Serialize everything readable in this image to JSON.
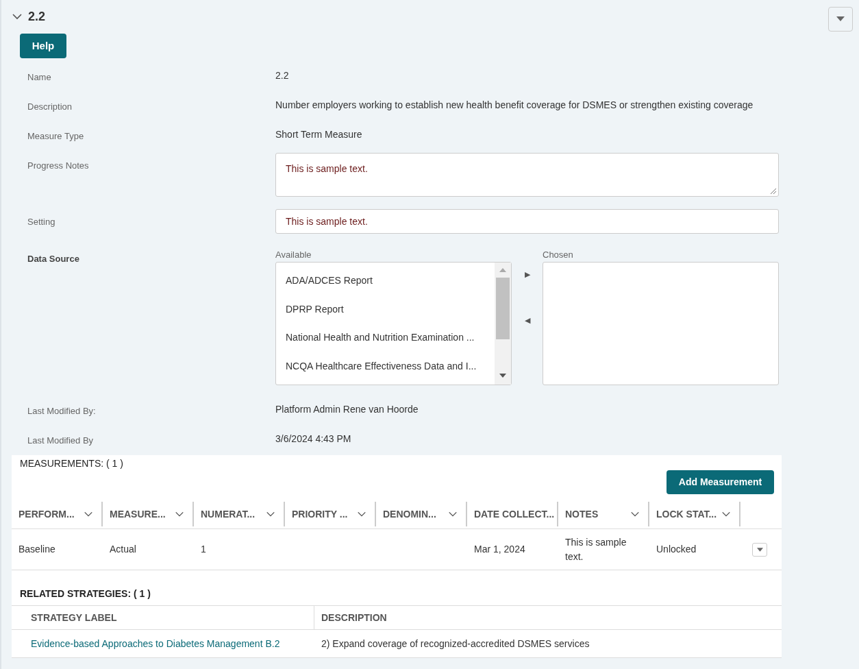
{
  "section": {
    "title": "2.2",
    "expanded": true
  },
  "help_button": "Help",
  "fields": [
    {
      "kind": "text",
      "label": "Name",
      "bold": false,
      "value": "2.2"
    },
    {
      "kind": "text",
      "label": "Description",
      "bold": false,
      "value": "Number employers working to establish new health benefit coverage for DSMES or strengthen existing coverage"
    },
    {
      "kind": "text",
      "label": "Measure Type",
      "bold": false,
      "value": "Short Term Measure"
    },
    {
      "kind": "textarea",
      "label": "Progress Notes",
      "bold": false,
      "value": "This is sample text."
    },
    {
      "kind": "input",
      "label": "Setting",
      "bold": false,
      "value": "This is sample text."
    },
    {
      "kind": "dual_list",
      "label": "Data Source",
      "bold": true,
      "available_label": "Available",
      "chosen_label": "Chosen",
      "available": [
        "ADA/ADCES Report",
        "DPRP Report",
        "National Health and Nutrition Examination ...",
        "NCQA Healthcare Effectiveness Data and I..."
      ],
      "move_right": "▶",
      "move_left": "◀"
    },
    {
      "kind": "text",
      "label": "Last Modified By:",
      "bold": false,
      "value": "Platform Admin Rene van Hoorde"
    },
    {
      "kind": "text",
      "label": "Last Modified By",
      "bold": false,
      "value": "3/6/2024 4:43 PM"
    }
  ],
  "measurements": {
    "title": "MEASUREMENTS: ( 1 )",
    "add_button": "Add Measurement",
    "columns": [
      "PERFORM...",
      "MEASURE...",
      "NUMERAT...",
      "PRIORITY ...",
      "DENOMIN...",
      "DATE COLLECT...",
      "NOTES",
      "LOCK STAT..."
    ],
    "column_sortable": [
      true,
      true,
      true,
      true,
      true,
      false,
      true,
      true
    ],
    "rows": [
      [
        "Baseline",
        "Actual",
        "1",
        "",
        "",
        "Mar 1, 2024",
        "This is sample text.",
        "Unlocked"
      ]
    ]
  },
  "related_strategies": {
    "title": "RELATED STRATEGIES: ( 1 )",
    "columns": [
      "STRATEGY LABEL",
      "DESCRIPTION"
    ],
    "rows": [
      {
        "label": "Evidence-based Approaches to Diabetes Management B.2",
        "description": "2) Expand coverage of recognized-accredited DSMES services"
      }
    ]
  }
}
